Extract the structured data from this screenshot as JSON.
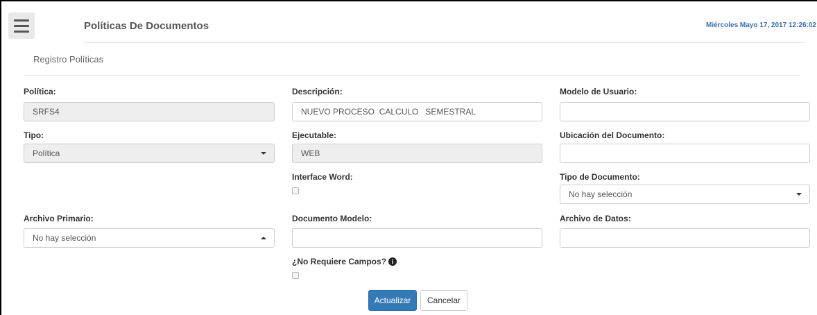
{
  "header": {
    "title": "Políticas De Documentos",
    "datetime": "Miércoles Mayo 17, 2017 12:26:02"
  },
  "section": {
    "title": "Registro Políticas"
  },
  "form": {
    "politica": {
      "label": "Política:",
      "value": "SRFS4"
    },
    "descripcion": {
      "label": "Descripción:",
      "value": "NUEVO PROCESO  CALCULO   SEMESTRAL"
    },
    "modelo_usuario": {
      "label": "Modelo de Usuario:",
      "value": ""
    },
    "tipo": {
      "label": "Tipo:",
      "selected": "Política"
    },
    "ejecutable": {
      "label": "Ejecutable:",
      "value": "WEB"
    },
    "ubicacion": {
      "label": "Ubicación del Documento:",
      "value": ""
    },
    "interface_word": {
      "label": "Interface Word:",
      "checked": false
    },
    "tipo_documento": {
      "label": "Tipo de Documento:",
      "selected": "No hay selección"
    },
    "archivo_primario": {
      "label": "Archivo Primario:",
      "selected": "No hay selección"
    },
    "documento_modelo": {
      "label": "Documento Modelo:",
      "value": ""
    },
    "archivo_datos": {
      "label": "Archivo de Datos:",
      "value": ""
    },
    "no_requiere_campos": {
      "label": "¿No Requiere Campos?",
      "checked": false
    }
  },
  "buttons": {
    "update": "Actualizar",
    "cancel": "Cancelar"
  },
  "icons": {
    "menu": "hamburger-menu-icon",
    "info": "info-circle-icon"
  },
  "colors": {
    "primary": "#337ab7",
    "datetime": "#3a6fb0"
  }
}
